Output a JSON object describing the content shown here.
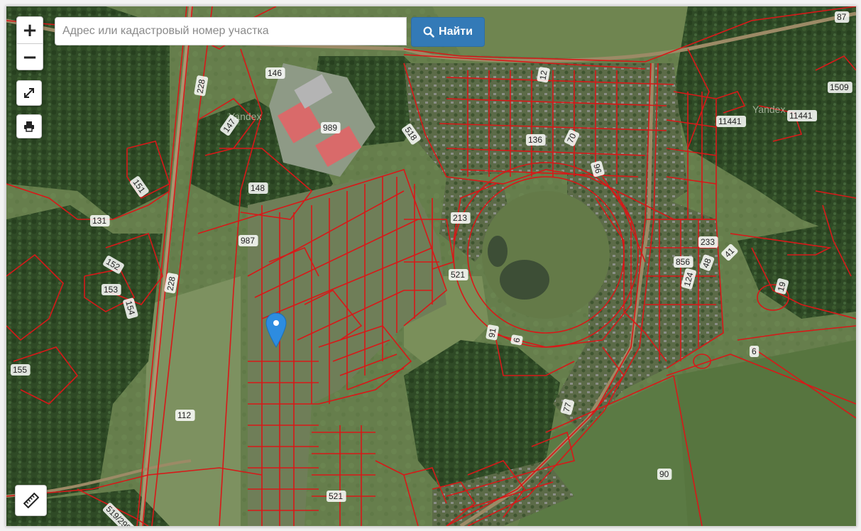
{
  "search": {
    "placeholder": "Адрес или кадастровый номер участка",
    "button_label": "Найти"
  },
  "controls": {
    "zoom_in": "+",
    "zoom_out": "−"
  },
  "map": {
    "watermarks": [
      "Yandex",
      "Yandex"
    ],
    "parcel_labels": [
      "87",
      "146",
      "228",
      "1509",
      "12",
      "989",
      "147",
      "518",
      "136",
      "11441",
      "11441",
      "70",
      "96",
      "151",
      "148",
      "213",
      "131",
      "987",
      "233",
      "856",
      "152",
      "521",
      "41",
      "48",
      "153",
      "154",
      "228",
      "124",
      "19",
      "91",
      "6",
      "6",
      "155",
      "112",
      "77",
      "90",
      "521",
      "519/299"
    ]
  }
}
